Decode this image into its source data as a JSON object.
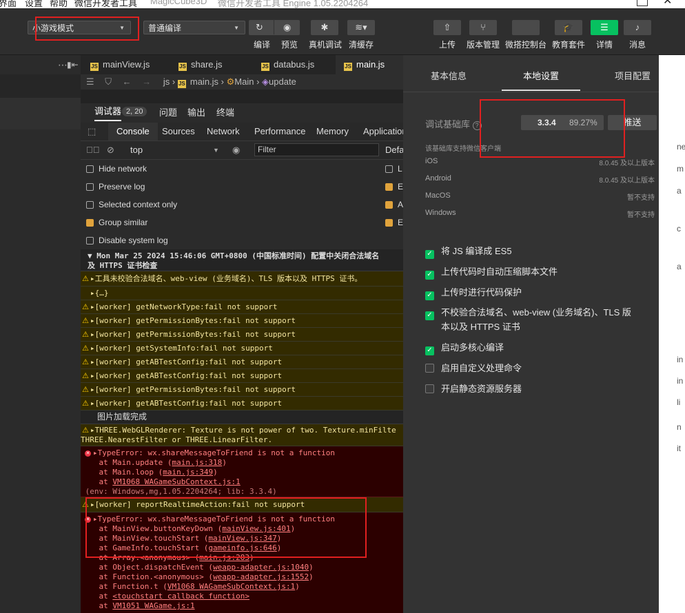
{
  "titlebar": {
    "menus": [
      "界面",
      "设置",
      "帮助",
      "微信开发者工具"
    ],
    "title": "MagicCube3D",
    "subtitle": "微信开发者工具 Engine 1.05.2204264"
  },
  "toolbar": {
    "mode_select": "小游戏模式",
    "compile_select": "普通编译",
    "left_buttons": [
      "编译",
      "预览",
      "真机调试",
      "清缓存"
    ],
    "right_buttons": [
      "上传",
      "版本管理",
      "微搭控制台",
      "教育套件",
      "详情",
      "消息"
    ]
  },
  "file_tabs": [
    "mainView.js",
    "share.js",
    "databus.js",
    "main.js"
  ],
  "breadcrumb": [
    "js",
    "main.js",
    "Main",
    "update"
  ],
  "debugger": {
    "tabs": [
      "调试器",
      "问题",
      "输出",
      "终端"
    ],
    "badge": "2, 20",
    "devtools_tabs": [
      "Console",
      "Sources",
      "Network",
      "Performance",
      "Memory",
      "Application"
    ],
    "context": "top",
    "filter_placeholder": "Filter",
    "default_label": "Defa",
    "options": [
      {
        "label": "Hide network",
        "checked": false
      },
      {
        "label": "Preserve log",
        "checked": false
      },
      {
        "label": "Selected context only",
        "checked": false
      },
      {
        "label": "Group similar",
        "checked": true
      },
      {
        "label": "Disable system log",
        "checked": false
      }
    ],
    "right_options": [
      {
        "label": "L",
        "checked": false
      },
      {
        "label": "E",
        "checked": true
      },
      {
        "label": "A",
        "checked": true
      },
      {
        "label": "E",
        "checked": true
      }
    ]
  },
  "console": {
    "header1": "▼ Mon Mar 25 2024 15:46:06 GMT+0800 (中国标准时间) 配置中关闭合法域名",
    "header2": "及 HTTPS 证书检查",
    "warn0": "▸工具未校验合法域名、web-view (业务域名)、TLS 版本以及 HTTPS 证书。",
    "obj": "▸{…}",
    "workers": [
      "▸[worker] getNetworkType:fail not support",
      "▸[worker] getPermissionBytes:fail not support",
      "▸[worker] getPermissionBytes:fail not support",
      "▸[worker] getSystemInfo:fail not support",
      "▸[worker] getABTestConfig:fail not support",
      "▸[worker] getABTestConfig:fail not support",
      "▸[worker] getPermissionBytes:fail not support",
      "▸[worker] getABTestConfig:fail not support"
    ],
    "img_loaded": "图片加载完成",
    "three1": "▸THREE.WebGLRenderer: Texture is not power of two. Texture.minFilte",
    "three2": "THREE.NearestFilter or THREE.LinearFilter.",
    "err1_title": "▸TypeError: wx.shareMessageToFriend is not a function",
    "err1_l1_pre": "    at Main.update (",
    "err1_l1_link": "main.js:318",
    "err1_l1_post": ")",
    "err1_l2_pre": "    at Main.loop (",
    "err1_l2_link": "main.js:349",
    "err1_l2_post": ")",
    "err1_l3_pre": "    at ",
    "err1_l3_link": "VM1068 WAGameSubContext.js:1",
    "err1_env": "(env: Windows,mg,1.05.2204264; lib: 3.3.4)",
    "worker_report": "▸[worker] reportRealtimeAction:fail not support",
    "err2_title": "▸TypeError: wx.shareMessageToFriend is not a function",
    "err2_l1_pre": "    at MainView.buttonKeyDown (",
    "err2_l1_link": "mainView.js:401",
    "err2_l1_post": ")",
    "err2_l2_pre": "    at MainView.touchStart (",
    "err2_l2_link": "mainView.js:347",
    "err2_l2_post": ")",
    "err2_l3_pre": "    at GameInfo.touchStart (",
    "err2_l3_link": "gameinfo.js:646",
    "err2_l3_post": ")",
    "err2_l4_pre": "    at Array.<anonymous> (",
    "err2_l4_link": "main.js:283",
    "err2_l4_post": ")",
    "err2_l5_pre": "    at Object.dispatchEvent (",
    "err2_l5_link": "weapp-adapter.js:1040",
    "err2_l5_post": ")",
    "err2_l6_pre": "    at Function.<anonymous> (",
    "err2_l6_link": "weapp-adapter.js:1552",
    "err2_l6_post": ")",
    "err2_l7_pre": "    at Function.t (",
    "err2_l7_link": "VM1068 WAGameSubContext.js:1",
    "err2_l7_post": ")",
    "err2_l8_pre": "    at ",
    "err2_l8_link": "<touchstart callback function>",
    "err2_l9_pre": "    at ",
    "err2_l9_link": "VM1051 WAGame.js:1"
  },
  "right_panel": {
    "tabs": [
      "基本信息",
      "本地设置",
      "项目配置"
    ],
    "lib_label": "调试基础库",
    "lib_version": "3.3.4",
    "lib_percent": "89.27%",
    "push_button": "推送",
    "support_title": "该基础库支持微信客户端",
    "platforms": [
      {
        "name": "iOS",
        "value": "8.0.45 及以上版本"
      },
      {
        "name": "Android",
        "value": "8.0.45 及以上版本"
      },
      {
        "name": "MacOS",
        "value": "暂不支持"
      },
      {
        "name": "Windows",
        "value": "暂不支持"
      }
    ],
    "settings": [
      {
        "label": "将 JS 编译成 ES5",
        "checked": true
      },
      {
        "label": "上传代码时自动压缩脚本文件",
        "checked": true
      },
      {
        "label": "上传时进行代码保护",
        "checked": true
      },
      {
        "label": "不校验合法域名、web-view (业务域名)、TLS 版",
        "label2": "本以及 HTTPS 证书",
        "checked": true
      },
      {
        "label": "启动多核心编译",
        "checked": true
      },
      {
        "label": "启用自定义处理命令",
        "checked": false
      },
      {
        "label": "开启静态资源服务器",
        "checked": false
      }
    ]
  },
  "far_right": [
    "ne",
    "m",
    "a",
    "c",
    "a",
    "in",
    "in",
    "li",
    "n",
    "it"
  ],
  "colors": {
    "warn_bg": "#332b00",
    "err_bg": "#2c0000",
    "green": "#07c160",
    "red_box": "#e02020"
  }
}
